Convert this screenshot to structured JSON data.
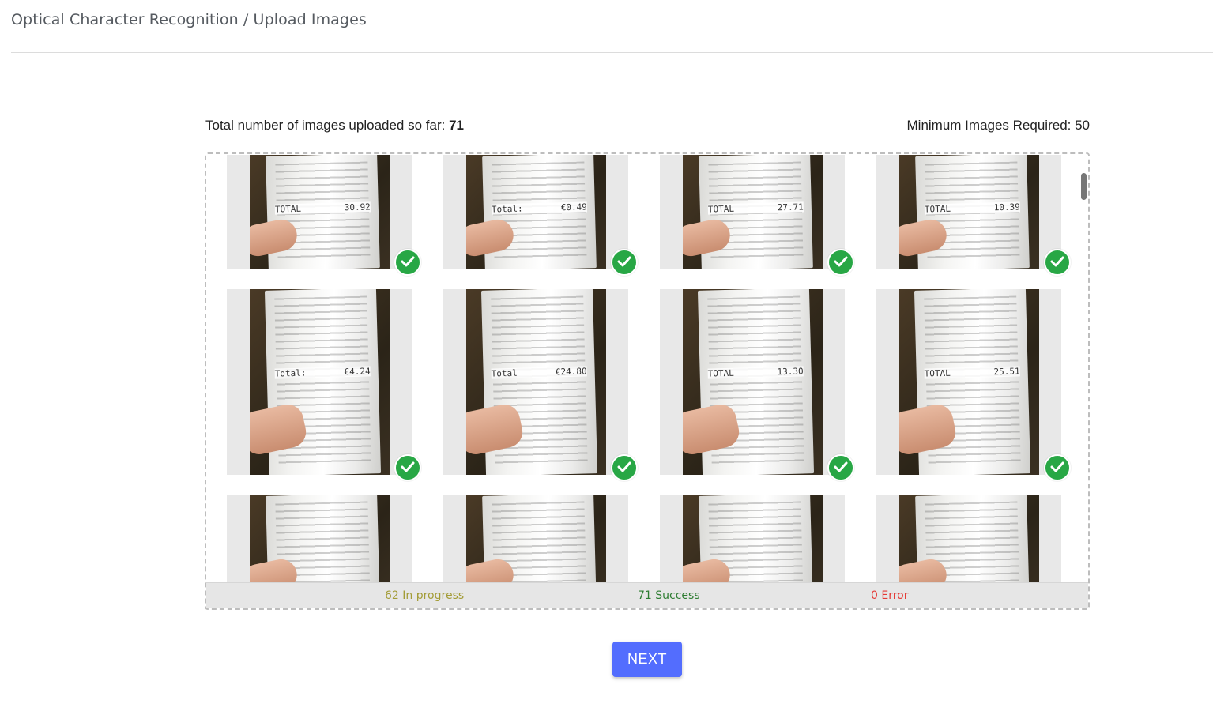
{
  "header": {
    "breadcrumb": "Optical Character Recognition / Upload Images"
  },
  "stats": {
    "uploaded_label": "Total number of images uploaded so far: ",
    "uploaded_count": "71",
    "minimum_label": "Minimum Images Required: 50"
  },
  "gallery": {
    "rows": [
      [
        {
          "total_label": "TOTAL",
          "total_value": "30.92",
          "status": "success"
        },
        {
          "total_label": "Total:",
          "total_value": "€0.49",
          "status": "success"
        },
        {
          "total_label": "TOTAL",
          "total_value": "27.71",
          "status": "success"
        },
        {
          "total_label": "TOTAL",
          "total_value": "10.39",
          "status": "success"
        }
      ],
      [
        {
          "total_label": "Total:",
          "total_value": "€4.24",
          "status": "success"
        },
        {
          "total_label": "Total",
          "total_value": "€24.80",
          "status": "success"
        },
        {
          "total_label": "TOTAL",
          "total_value": "13.30",
          "status": "success"
        },
        {
          "total_label": "TOTAL",
          "total_value": "25.51",
          "status": "success"
        }
      ],
      [
        {
          "total_label": "",
          "total_value": "",
          "status": "partial"
        },
        {
          "total_label": "",
          "total_value": "",
          "status": "partial"
        },
        {
          "total_label": "",
          "total_value": "",
          "status": "partial"
        },
        {
          "total_label": "",
          "total_value": "",
          "status": "partial"
        }
      ]
    ],
    "success_color": "#28a745"
  },
  "status_bar": {
    "in_progress": "62 In progress",
    "success": "71 Success",
    "error": "0 Error",
    "colors": {
      "in_progress": "#a39c36",
      "success": "#2e7d32",
      "error": "#e53935"
    }
  },
  "actions": {
    "next_label": "NEXT",
    "accent": "#536dfe"
  }
}
